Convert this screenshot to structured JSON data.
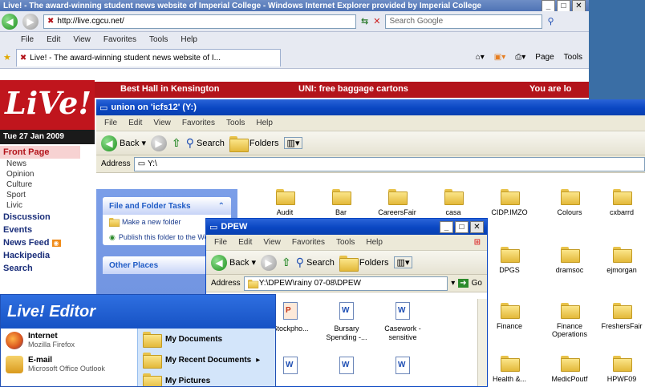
{
  "browser": {
    "title": "Live! - The award-winning student news website of Imperial College - Windows Internet Explorer provided by Imperial College",
    "address": "http://live.cgcu.net/",
    "search_placeholder": "Search Google",
    "menu": [
      "File",
      "Edit",
      "View",
      "Favorites",
      "Tools",
      "Help"
    ],
    "tab_label": "Live! - The award-winning student news website of I...",
    "commands": [
      "Page",
      "Tools"
    ],
    "site": {
      "logo": "LiVe!",
      "banner_left": "Best Hall in Kensington",
      "banner_mid": "UNI: free baggage cartons",
      "banner_right": "You are lo",
      "date": "Tue 27 Jan 2009",
      "nav_active": "Front Page",
      "nav_sub": [
        "News",
        "Opinion",
        "Culture",
        "Sport",
        "Livic"
      ],
      "nav_main": [
        "Discussion",
        "Events",
        "News Feed",
        "Hackipedia",
        "Search"
      ]
    }
  },
  "explorer": {
    "title": "union on 'icfs12' (Y:)",
    "menu": [
      "File",
      "Edit",
      "View",
      "Favorites",
      "Tools",
      "Help"
    ],
    "back_label": "Back",
    "search_label": "Search",
    "folders_label": "Folders",
    "address_label": "Address",
    "address": "Y:\\",
    "tasks_title": "File and Folder Tasks",
    "tasks": [
      "Make a new folder",
      "Publish this folder to the Web"
    ],
    "other_places_title": "Other Places",
    "folders": [
      "Audit",
      "Bar",
      "CareersFair",
      "casa",
      "CIDP.IMZO",
      "Colours",
      "cxbarrd",
      "DPGS",
      "dramsoc",
      "ejmorgan",
      "Finance",
      "Finance Operations",
      "FreshersFair",
      "Health &...",
      "MedicPoutf",
      "HPWF09"
    ]
  },
  "dpew": {
    "title": "DPEW",
    "menu": [
      "File",
      "Edit",
      "View",
      "Favorites",
      "Tools",
      "Help"
    ],
    "back_label": "Back",
    "search_label": "Search",
    "folders_label": "Folders",
    "address_label": "Address",
    "address": "Y:\\DPEW\\rainy 07-08\\DPEW",
    "go_label": "Go",
    "files": [
      "Stockpho...",
      "Bursary Spending -...",
      "Casework - sensitive",
      "",
      "",
      ""
    ]
  },
  "startmenu": {
    "header": "Live! Editor",
    "left_items": [
      {
        "title": "Internet",
        "sub": "Mozilla Firefox"
      },
      {
        "title": "E-mail",
        "sub": "Microsoft Office Outlook"
      }
    ],
    "right_items": [
      "My Documents",
      "My Recent Documents",
      "My Pictures"
    ]
  },
  "colors": {
    "live_red": "#b3141b",
    "xp_blue": "#0a46c2",
    "desktop": "#3a6ea5"
  }
}
